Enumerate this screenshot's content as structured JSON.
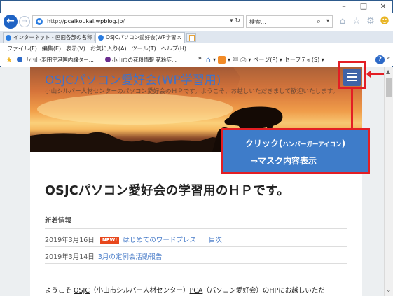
{
  "window": {
    "controls": [
      "–",
      "□",
      "×"
    ]
  },
  "address_bar": {
    "url_prefix": "http://",
    "url_domain": "pcaikoukai.wpblog.jp",
    "url_suffix": "/",
    "url_arrows": "▾ ↻",
    "search_placeholder": "検索...",
    "search_drop": "▾"
  },
  "tabs": [
    {
      "label": "インターネット - 画面各部の名称 | ..."
    },
    {
      "label": "OSJCパソコン愛好会(WP学習...",
      "close": "×"
    }
  ],
  "menu": {
    "items": [
      "ファイル(F)",
      "編集(E)",
      "表示(V)",
      "お気に入り(A)",
      "ツール(T)",
      "ヘルプ(H)"
    ]
  },
  "favorites": {
    "items": [
      "「小山-羽田空港国内線ター...",
      "小山市の花粉情報 花粉症..."
    ],
    "chevron": "»",
    "commands": {
      "page": "ページ(P) ▾",
      "safety": "セーフティ(S) ▾"
    },
    "help_icon": "?",
    "more": "»"
  },
  "banner": {
    "site_title": "OSJCパソコン愛好会(WP学習用)",
    "site_description": "小山シルバー人材センターのパソコン愛好会のＨＰです。ようこそ、お越しいただきまして歓迎いたします。"
  },
  "callout": {
    "line1_main": "クリック(",
    "line1_small": "ハンバーガーアイコン",
    "line1_end": ")",
    "line2": "⇒マスク内容表示"
  },
  "content": {
    "heading": "OSJCパソコン愛好会の学習用のＨＰです。",
    "news_title": "新着情報",
    "news": [
      {
        "date": "2019年3月16日",
        "badge": "NEW!",
        "link": "はじめてのワードプレス",
        "link2": "目次"
      },
      {
        "date": "2019年3月14日",
        "link": "3月の定例会活動報告"
      }
    ],
    "welcome": {
      "prefix": "ようこそ ",
      "osjc": "OSJC",
      "mid": "（小山市シルバー人材センター）",
      "pca": "PCA",
      "end": "（パソコン愛好会）のHPにお越しいただ"
    }
  },
  "colors": {
    "accent_blue": "#3e7cc9",
    "annotation_red": "#e31e24",
    "link_blue": "#4a7dc9",
    "new_badge": "#e8471c"
  }
}
